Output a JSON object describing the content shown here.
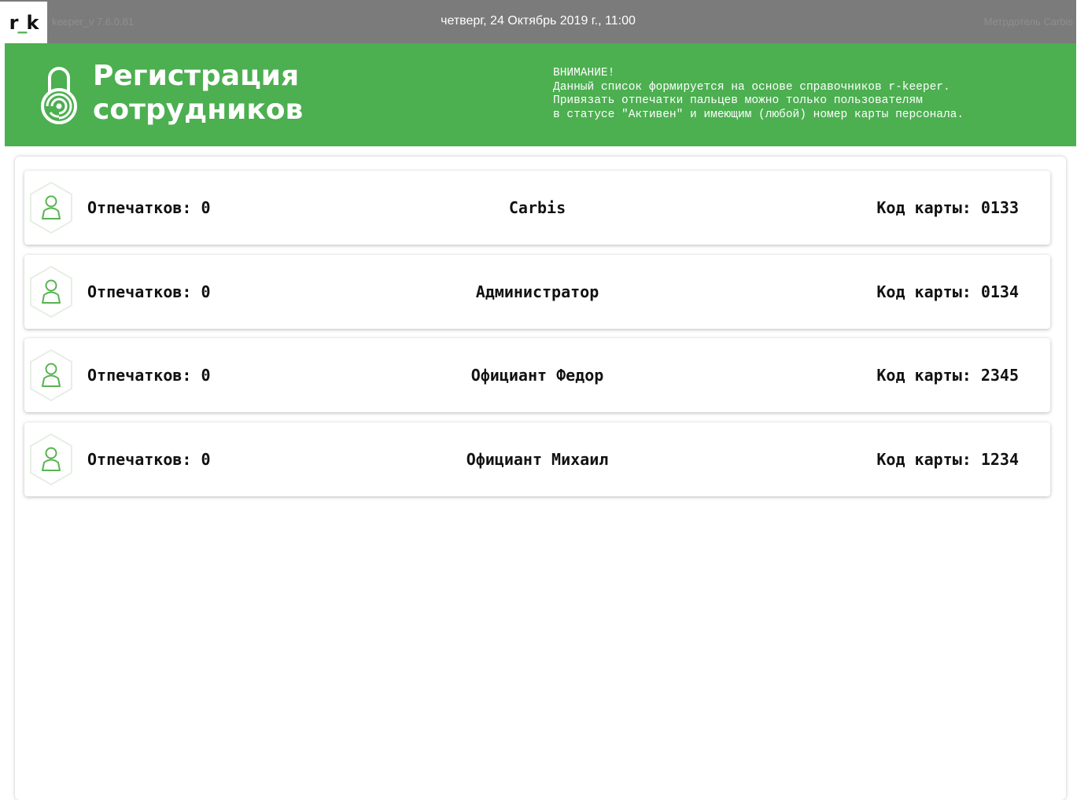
{
  "topbar": {
    "logo_left": "r",
    "logo_mid": "_",
    "logo_right": "k",
    "version": "keeper_v 7.6.0.81",
    "datetime": "четверг, 24 Октябрь 2019 г., 11:00",
    "user": "Метрдотель Carbis"
  },
  "header": {
    "title_line1": "Регистрация",
    "title_line2": "сотрудников",
    "warning_title": "ВНИМАНИЕ!",
    "warning_line1": "Данный список формируется на основе справочников r-keeper.",
    "warning_line2": "Привязать отпечатки пальцев можно только пользователям",
    "warning_line3": "в статусе \"Активен\" и имеющим (любой) номер карты персонала."
  },
  "employees": [
    {
      "prints_label": "Отпечатков: 0",
      "name": "Carbis",
      "card_label": "Код карты: 0133"
    },
    {
      "prints_label": "Отпечатков: 0",
      "name": "Администратор",
      "card_label": "Код карты: 0134"
    },
    {
      "prints_label": "Отпечатков: 0",
      "name": "Официант Федор",
      "card_label": "Код карты: 2345"
    },
    {
      "prints_label": "Отпечатков: 0",
      "name": "Официант Михаил",
      "card_label": "Код карты: 1234"
    }
  ],
  "colors": {
    "accent": "#4caf50",
    "topbar": "#7b7b7b"
  },
  "icons": {
    "header": "fingerprint-lock-icon",
    "row": "user-hexagon-icon"
  }
}
